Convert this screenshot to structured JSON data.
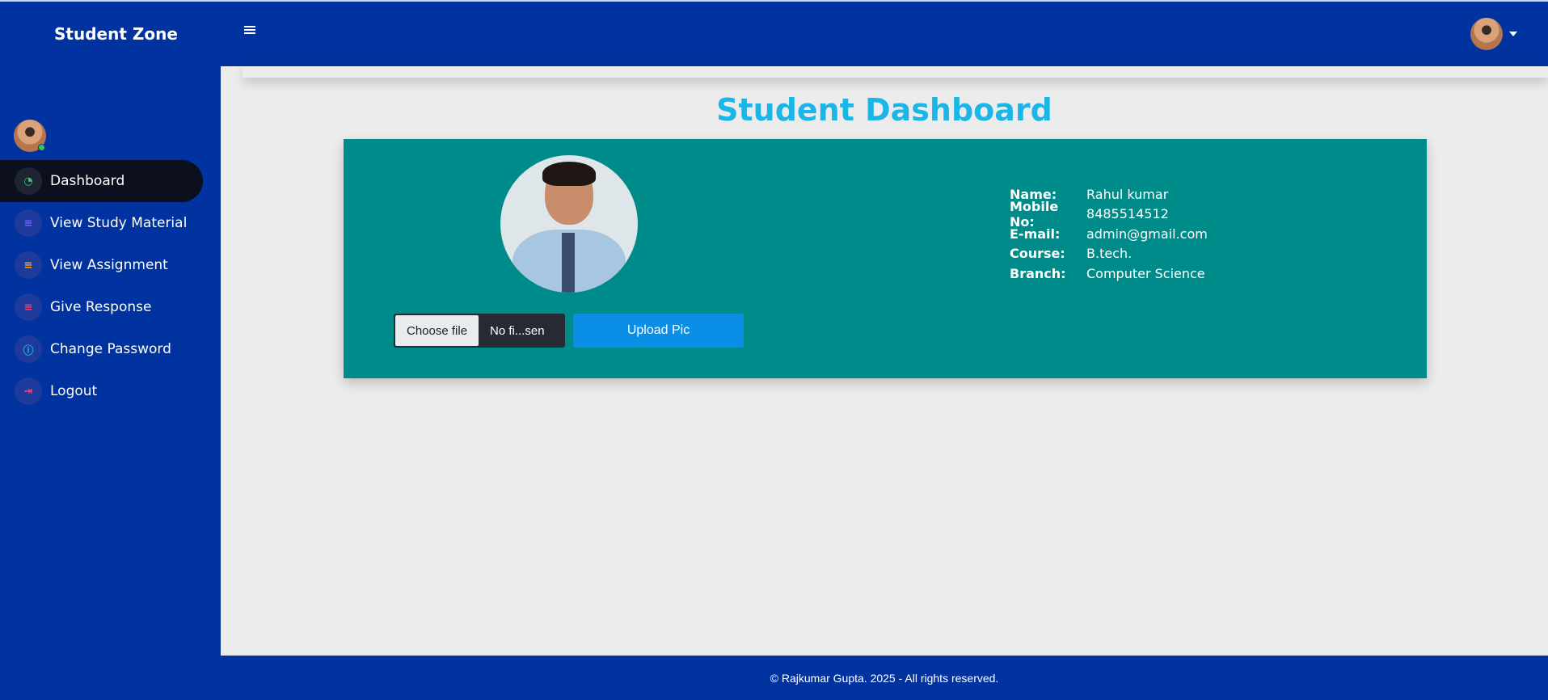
{
  "app": {
    "brand": "Student Zone"
  },
  "header": {
    "menu_icon": "hamburger-icon",
    "user_avatar_icon": "user-avatar"
  },
  "sidebar": {
    "items": [
      {
        "label": "Dashboard",
        "icon": "speedometer-icon",
        "icon_color": "#2ecc71",
        "active": true
      },
      {
        "label": "View Study Material",
        "icon": "list-icon",
        "icon_color": "#6c63ff"
      },
      {
        "label": "View Assignment",
        "icon": "list-icon",
        "icon_color": "#ff9f1c"
      },
      {
        "label": "Give Response",
        "icon": "list-icon",
        "icon_color": "#ff3b6b"
      },
      {
        "label": "Change Password",
        "icon": "info-icon",
        "icon_color": "#1bb6e8"
      },
      {
        "label": "Logout",
        "icon": "logout-icon",
        "icon_color": "#ff3b6b"
      }
    ]
  },
  "main": {
    "title": "Student Dashboard",
    "upload": {
      "choose_label": "Choose file",
      "file_status": "No fi...sen",
      "upload_label": "Upload Pic"
    },
    "profile": {
      "fields": [
        {
          "key": "Name:",
          "value": "Rahul kumar"
        },
        {
          "key": "Mobile No:",
          "value": "8485514512"
        },
        {
          "key": "E-mail:",
          "value": "admin@gmail.com"
        },
        {
          "key": "Course:",
          "value": "B.tech."
        },
        {
          "key": "Branch:",
          "value": "Computer Science"
        }
      ]
    }
  },
  "footer": {
    "text": "© Rajkumar Gupta. 2025 - All rights reserved."
  },
  "colors": {
    "primary": "#0033a0",
    "card": "#008b8b",
    "title": "#1bb6e8",
    "button": "#0b8ee6"
  }
}
